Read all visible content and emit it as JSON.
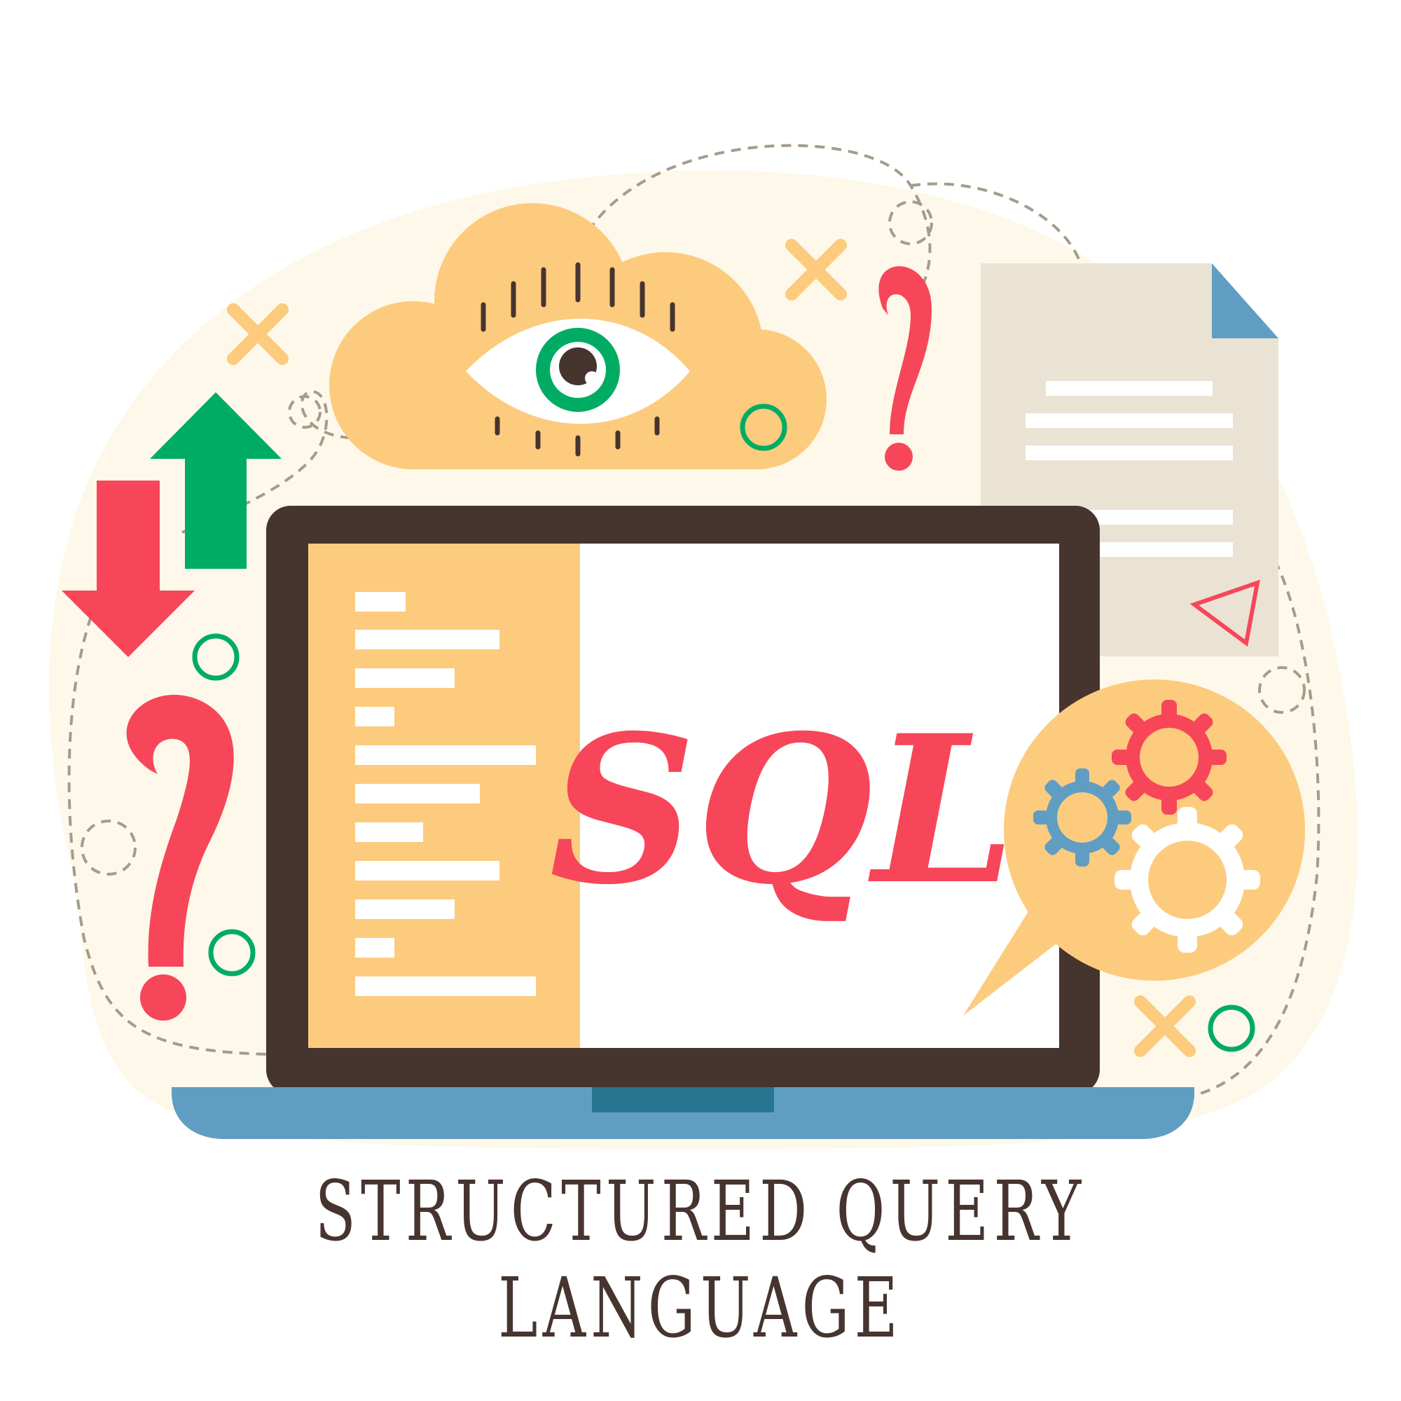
{
  "screen_text": "SQL",
  "caption": "STRUCTURED QUERY LANGUAGE",
  "colors": {
    "background_blob": "#fdf8e9",
    "cloud": "#fccb7e",
    "red": "#f74659",
    "green": "#00ac63",
    "laptop_frame": "#46342f",
    "laptop_base": "#5f9ec2",
    "laptop_notch": "#287592",
    "document": "#eae3d4",
    "document_fold": "#5f9ec2",
    "gear_blue": "#5f9ec2",
    "gear_red": "#f74659",
    "gear_white": "#ffffff",
    "dash": "#a59b8b"
  },
  "icons": [
    "eye-icon",
    "up-arrow-icon",
    "down-arrow-icon",
    "question-mark-icon",
    "document-icon",
    "gear-icon",
    "cross-icon",
    "circle-icon",
    "laptop-icon",
    "cloud-icon",
    "speech-bubble-icon",
    "triangle-icon"
  ]
}
